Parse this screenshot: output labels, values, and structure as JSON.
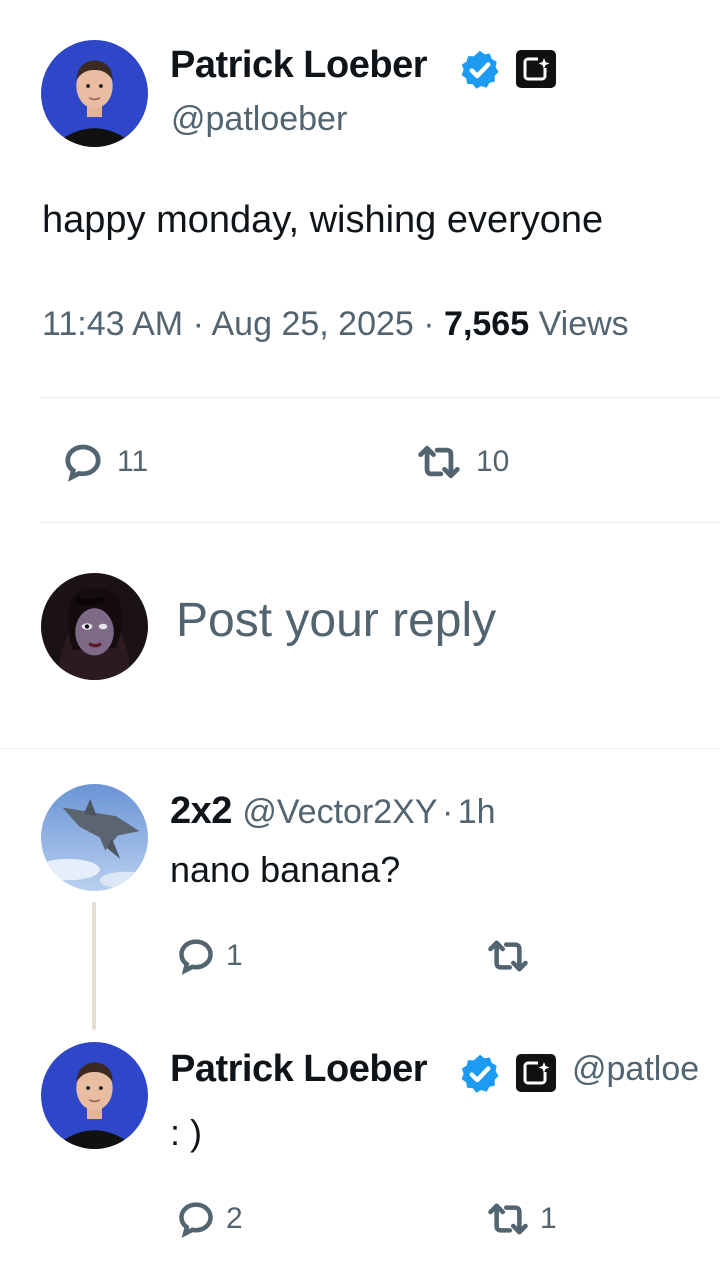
{
  "main_tweet": {
    "author_name": "Patrick Loeber",
    "author_handle": "@patloeber",
    "text": "happy monday, wishing everyone",
    "time": "11:43 AM",
    "date": "Aug 25, 2025",
    "views_count": "7,565",
    "views_label": "Views",
    "replies": "11",
    "reposts": "10"
  },
  "composer": {
    "placeholder": "Post your reply"
  },
  "replies": [
    {
      "author_name": "2x2",
      "author_handle": "@Vector2XY",
      "age": "1h",
      "text": "nano banana?",
      "replies": "1",
      "reposts": ""
    },
    {
      "author_name": "Patrick Loeber",
      "author_handle": "@patloe",
      "text": ": )",
      "replies": "2",
      "reposts": "1"
    }
  ],
  "colors": {
    "verified_blue": "#1d9bf0",
    "avatar_bg_blue": "#2e47c9",
    "text": "#0f1419",
    "secondary": "#536471"
  }
}
